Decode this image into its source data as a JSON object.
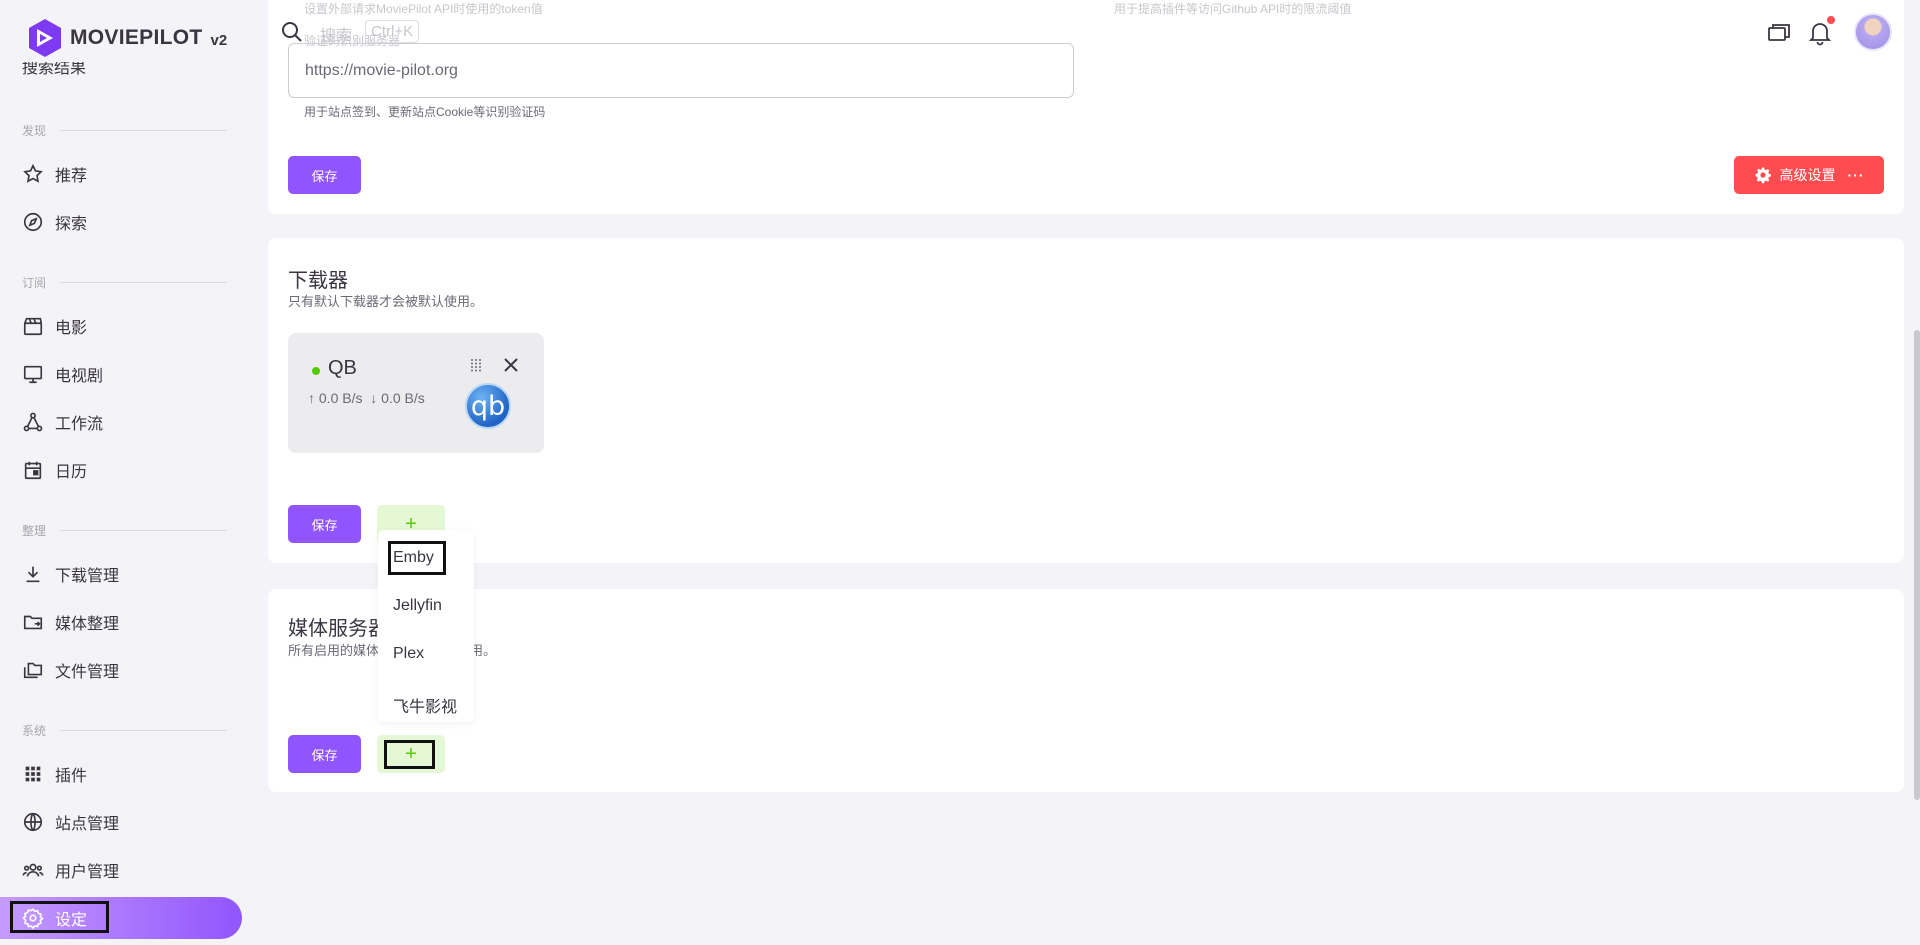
{
  "brand": {
    "name": "MOVIEPILOT",
    "version": "v2"
  },
  "topbar": {
    "search_placeholder": "搜索",
    "shortcut": "Ctrl+K"
  },
  "sidebar": {
    "partial_item": "搜索结果",
    "sections": {
      "discover": "发现",
      "subscribe": "订阅",
      "organize": "整理",
      "system": "系统"
    },
    "items": {
      "recommend": "推荐",
      "explore": "探索",
      "movies": "电影",
      "tv": "电视剧",
      "workflow": "工作流",
      "calendar": "日历",
      "downloads": "下载管理",
      "media_organize": "媒体整理",
      "files": "文件管理",
      "plugins": "插件",
      "sites": "站点管理",
      "users": "用户管理",
      "settings": "设定"
    }
  },
  "system_card": {
    "faint_hint_left": "设置外部请求MoviePilot API时使用的token值",
    "faint_hint_right": "用于提高插件等访问Github API时的限流阈值",
    "faint_label": "验证码识别服务器",
    "ocr_server_value": "https://movie-pilot.org",
    "ocr_helper": "用于站点签到、更新站点Cookie等识别验证码",
    "save_label": "保存",
    "advanced_label": "高级设置",
    "advanced_more": "···"
  },
  "downloader_card": {
    "title": "下载器",
    "subtitle": "只有默认下载器才会被默认使用。",
    "client": {
      "name": "QB",
      "status_color": "#56ca00",
      "upload": "↑ 0.0 B/s",
      "download": "↓ 0.0 B/s",
      "logo_text": "qb"
    },
    "save_label": "保存",
    "add_label": "+"
  },
  "media_card": {
    "title": "媒体服务器",
    "subtitle": "所有启用的媒体服务器都会被使用。",
    "save_label": "保存",
    "add_label": "+"
  },
  "dropdown": {
    "options": [
      "Emby",
      "Jellyfin",
      "Plex",
      "飞牛影视"
    ]
  },
  "colors": {
    "primary": "#9155fd",
    "danger": "#ff4c51",
    "success": "#56ca00"
  }
}
